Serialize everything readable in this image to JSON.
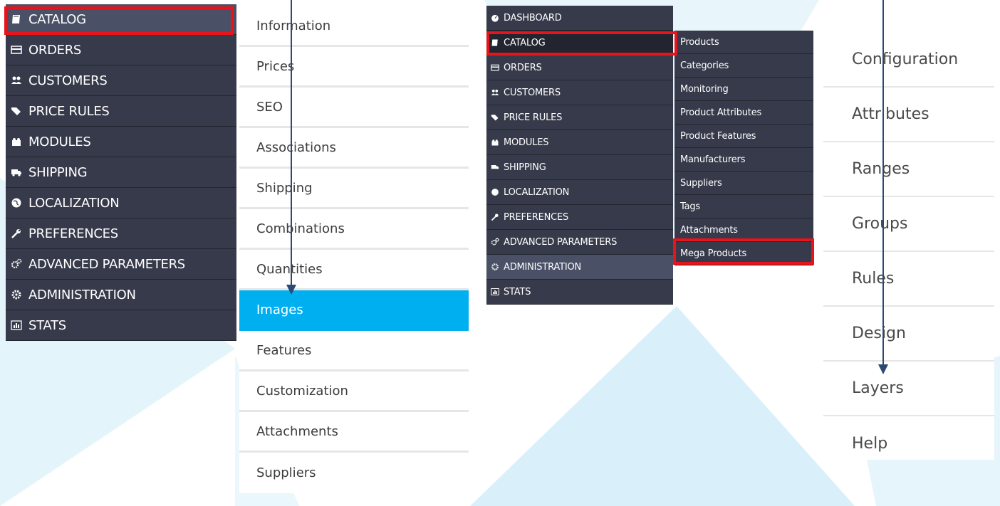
{
  "menu_left": {
    "items": [
      {
        "label": "CATALOG",
        "icon": "book-icon"
      },
      {
        "label": "ORDERS",
        "icon": "credit-card-icon"
      },
      {
        "label": "CUSTOMERS",
        "icon": "users-icon"
      },
      {
        "label": "PRICE RULES",
        "icon": "tags-icon"
      },
      {
        "label": "MODULES",
        "icon": "puzzle-icon"
      },
      {
        "label": "SHIPPING",
        "icon": "truck-icon"
      },
      {
        "label": "LOCALIZATION",
        "icon": "globe-icon"
      },
      {
        "label": "PREFERENCES",
        "icon": "wrench-icon"
      },
      {
        "label": "ADVANCED PARAMETERS",
        "icon": "cogs-icon"
      },
      {
        "label": "ADMINISTRATION",
        "icon": "cog-icon"
      },
      {
        "label": "STATS",
        "icon": "bar-chart-icon"
      }
    ]
  },
  "product_tabs": {
    "items": [
      "Information",
      "Prices",
      "SEO",
      "Associations",
      "Shipping",
      "Combinations",
      "Quantities",
      "Images",
      "Features",
      "Customization",
      "Attachments",
      "Suppliers"
    ],
    "active": "Images"
  },
  "menu_right": {
    "items": [
      {
        "label": "DASHBOARD",
        "icon": "dashboard-icon"
      },
      {
        "label": "CATALOG",
        "icon": "book-icon"
      },
      {
        "label": "ORDERS",
        "icon": "credit-card-icon"
      },
      {
        "label": "CUSTOMERS",
        "icon": "users-icon"
      },
      {
        "label": "PRICE RULES",
        "icon": "tags-icon"
      },
      {
        "label": "MODULES",
        "icon": "puzzle-icon"
      },
      {
        "label": "SHIPPING",
        "icon": "truck-icon"
      },
      {
        "label": "LOCALIZATION",
        "icon": "globe-icon"
      },
      {
        "label": "PREFERENCES",
        "icon": "wrench-icon"
      },
      {
        "label": "ADVANCED PARAMETERS",
        "icon": "cogs-icon"
      },
      {
        "label": "ADMINISTRATION",
        "icon": "cog-icon"
      },
      {
        "label": "STATS",
        "icon": "bar-chart-icon"
      }
    ],
    "submenu": [
      "Products",
      "Categories",
      "Monitoring",
      "Product Attributes",
      "Product Features",
      "Manufacturers",
      "Suppliers",
      "Tags",
      "Attachments",
      "Mega Products"
    ]
  },
  "config_tabs": [
    "Configuration",
    "Attributes",
    "Ranges",
    "Groups",
    "Rules",
    "Design",
    "Layers",
    "Help"
  ],
  "colors": {
    "menu_bg": "#363a4a",
    "menu_active": "#4a5166",
    "tab_active": "#00aff0",
    "highlight": "#e8141c",
    "arrow": "#2b4a73",
    "background_shape": "#dff3fb"
  }
}
